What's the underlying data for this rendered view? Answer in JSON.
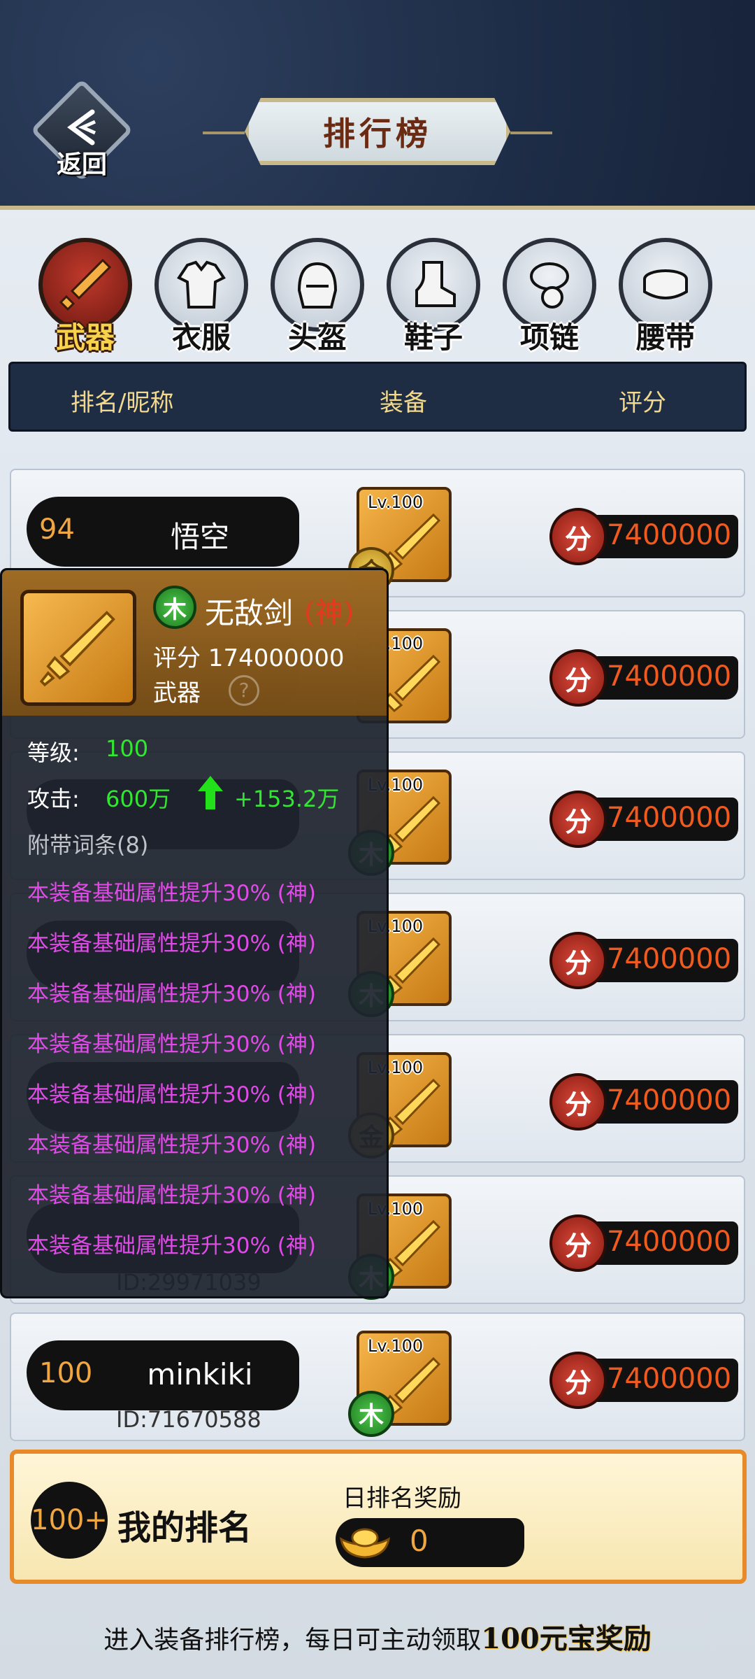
{
  "header": {
    "back_label": "返回",
    "title": "排行榜"
  },
  "categories": [
    {
      "label": "武器",
      "icon": "sword-icon",
      "active": true
    },
    {
      "label": "衣服",
      "icon": "robe-icon",
      "active": false
    },
    {
      "label": "头盔",
      "icon": "helmet-icon",
      "active": false
    },
    {
      "label": "鞋子",
      "icon": "boot-icon",
      "active": false
    },
    {
      "label": "项链",
      "icon": "necklace-icon",
      "active": false
    },
    {
      "label": "腰带",
      "icon": "belt-icon",
      "active": false
    }
  ],
  "columns": {
    "rank_name": "排名/昵称",
    "equipment": "装备",
    "score": "评分"
  },
  "rows": [
    {
      "rank": "94",
      "name": "悟空",
      "id": "",
      "lv": "Lv.100",
      "element": "金",
      "score_icon": "分",
      "score": "7400000"
    },
    {
      "rank": "",
      "name": "",
      "id": "",
      "lv": "Lv.100",
      "element": "",
      "score_icon": "分",
      "score": "7400000"
    },
    {
      "rank": "",
      "name": "",
      "id": "",
      "lv": "Lv.100",
      "element": "木",
      "score_icon": "分",
      "score": "7400000"
    },
    {
      "rank": "",
      "name": "",
      "id": "",
      "lv": "Lv.100",
      "element": "木",
      "score_icon": "分",
      "score": "7400000"
    },
    {
      "rank": "",
      "name": "",
      "id": "",
      "lv": "Lv.100",
      "element": "金",
      "score_icon": "分",
      "score": "7400000"
    },
    {
      "rank": "",
      "name": "",
      "id": "ID:29971039",
      "lv": "Lv.100",
      "element": "木",
      "score_icon": "分",
      "score": "7400000"
    },
    {
      "rank": "100",
      "name": "minkiki",
      "id": "ID:71670588",
      "lv": "Lv.100",
      "element": "木",
      "score_icon": "分",
      "score": "7400000"
    }
  ],
  "tooltip": {
    "element": "木",
    "name": "无敌剑",
    "tier": "(神)",
    "score": "评分 174000000",
    "type": "武器",
    "help": "?",
    "level_label": "等级:",
    "level_value": "100",
    "attack_label": "攻击:",
    "attack_value": "600万",
    "attack_bonus": "+153.2万",
    "affix_title": "附带词条(8)",
    "affixes": [
      "本装备基础属性提升30% (神)",
      "本装备基础属性提升30% (神)",
      "本装备基础属性提升30% (神)",
      "本装备基础属性提升30% (神)",
      "本装备基础属性提升30% (神)",
      "本装备基础属性提升30% (神)",
      "本装备基础属性提升30% (神)",
      "本装备基础属性提升30% (神)"
    ]
  },
  "my_rank": {
    "rank": "100+",
    "title": "我的排名",
    "reward_label": "日排名奖励",
    "reward_value": "0"
  },
  "footer": {
    "tip": "进入装备排行榜，每日可主动领取",
    "tip_highlight": "100元宝奖励"
  },
  "colors": {
    "header_bg": "#1e2d47",
    "gold_accent": "#f2d98c",
    "score_text": "#f05a1e",
    "rank_orange": "#f0a742",
    "affix_purple": "#e04be8",
    "positive_green": "#32e632"
  }
}
